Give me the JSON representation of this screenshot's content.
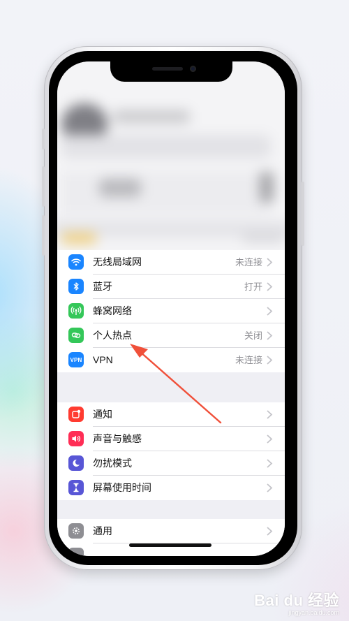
{
  "settings": {
    "group1": [
      {
        "label": "无线局域网",
        "value": "未连接",
        "icon": "wifi-icon",
        "color": "#1a85ff"
      },
      {
        "label": "蓝牙",
        "value": "打开",
        "icon": "bluetooth-icon",
        "color": "#1a85ff"
      },
      {
        "label": "蜂窝网络",
        "value": "",
        "icon": "cellular-icon",
        "color": "#34c759"
      },
      {
        "label": "个人热点",
        "value": "关闭",
        "icon": "hotspot-icon",
        "color": "#34c759"
      },
      {
        "label": "VPN",
        "value": "未连接",
        "icon": "vpn-icon",
        "color": "#1a85ff",
        "badge": "VPN"
      }
    ],
    "group2": [
      {
        "label": "通知",
        "icon": "notification-icon",
        "color": "#ff3b30"
      },
      {
        "label": "声音与触感",
        "icon": "sound-icon",
        "color": "#ff2d55"
      },
      {
        "label": "勿扰模式",
        "icon": "moon-icon",
        "color": "#5856d6"
      },
      {
        "label": "屏幕使用时间",
        "icon": "hourglass-icon",
        "color": "#5856d6"
      }
    ],
    "group3": [
      {
        "label": "通用",
        "icon": "gear-icon",
        "color": "#8e8e93"
      }
    ]
  },
  "annotation": {
    "arrow_color": "#f0503a"
  },
  "watermark": {
    "logo": "Bai du 经验",
    "url": "jingyan.baidu.com"
  }
}
